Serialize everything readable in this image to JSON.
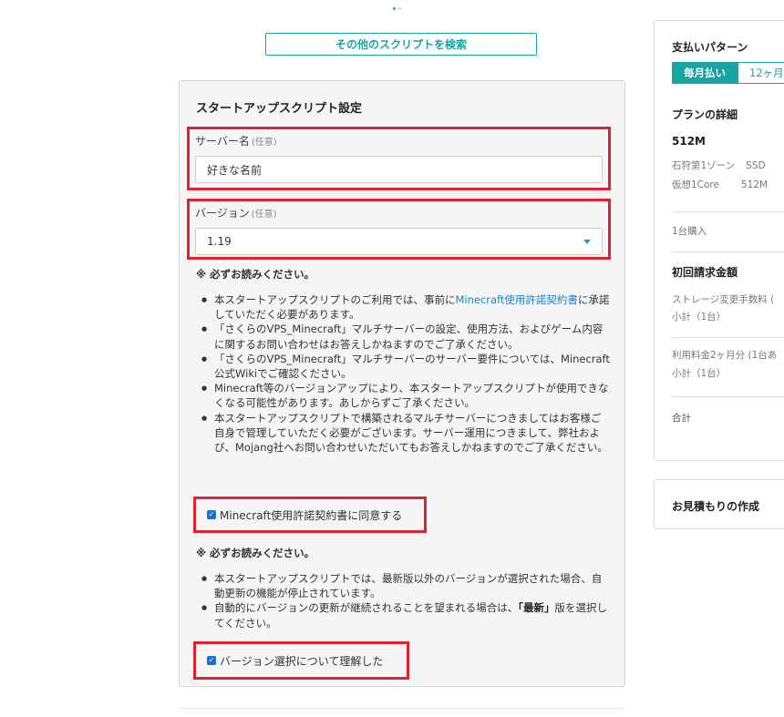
{
  "search_button": "その他のスクリプトを検索",
  "panel": {
    "title": "スタートアップスクリプト設定",
    "server_label": "サーバー名",
    "server_optional": "(任意)",
    "server_value": "好きな名前",
    "version_label": "バージョン",
    "version_optional": "(任意)",
    "version_value": "1.19",
    "notice1": "※ 必ずお読みください。",
    "bullets1": {
      "b0_pre": "本スタートアップスクリプトのご利用では、事前に",
      "b0_link": "Minecraft使用許諾契約書",
      "b0_post": "に承諾していただく必要があります。",
      "b1": "「さくらのVPS_Minecraft」マルチサーバーの設定、使用方法、およびゲーム内容に関するお問い合わせはお答えしかねますのでご了承ください。",
      "b2": "「さくらのVPS_Minecraft」マルチサーバーのサーバー要件については、Minecraft公式Wikiでご確認ください。",
      "b3": "Minecraft等のバージョンアップにより、本スタートアップスクリプトが使用できなくなる可能性があります。あしからずご了承ください。",
      "b4": "本スタートアップスクリプトで構築されるマルチサーバーにつきましてはお客様ご自身で管理していただく必要がございます。サーバー運用につきまして、弊社および、Mojang社へお問い合わせいただいてもお答えしかねますのでご了承ください。"
    },
    "check1": "Minecraft使用許諾契約書に同意する",
    "notice2": "※ 必ずお読みください。",
    "bullets2": {
      "b0": "本スタートアップスクリプトでは、最新版以外のバージョンが選択された場合、自動更新の機能が停止されています。",
      "b1_pre": "自動的にバージョンの更新が継続されることを望まれる場合は、",
      "b1_bold": "「最新」",
      "b1_post": "版を選択してください。"
    },
    "check2": "バージョン選択について理解した"
  },
  "sidebar": {
    "payment_title": "支払いパターン",
    "tab_monthly": "毎月払い",
    "tab_12": "12ヶ月",
    "plan_title": "プランの詳細",
    "plan_name": "512M",
    "plan_zone": "石狩第1ゾーン",
    "plan_storage": "SSD",
    "plan_cpu": "仮想1Core",
    "plan_mem": "512M",
    "purchase_count": "1台購入",
    "initial_title": "初回請求金額",
    "storage_fee": "ストレージ変更手数料 (",
    "subtotal1": "小計（1台）",
    "usage_fee": "利用料金2ヶ月分 (1台あ",
    "subtotal2": "小計（1台）",
    "total": "合計",
    "quote_title": "お見積もりの作成"
  }
}
